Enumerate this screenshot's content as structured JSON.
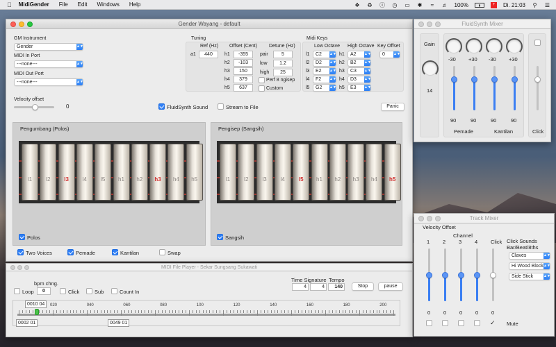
{
  "menubar": {
    "app": "MidiGender",
    "items": [
      "File",
      "Edit",
      "Windows",
      "Help"
    ],
    "battery": "100%",
    "clock": "Di. 21:03"
  },
  "main": {
    "title": "Gender Wayang - default",
    "gm_label": "GM Instrument",
    "gm_value": "Gender",
    "midi_in_label": "MIDI In Port",
    "midi_in_value": "---none---",
    "midi_out_label": "MIDI Out Port",
    "midi_out_value": "---none---",
    "tuning": {
      "label": "Tuning",
      "ref_label": "Ref (Hz)",
      "a1_label": "a1",
      "ref_value": "440",
      "offset_label": "Offset (Cent)",
      "detune_label": "Detune (Hz)",
      "rows": [
        {
          "n": "h1",
          "v": "-355"
        },
        {
          "n": "h2",
          "v": "-103"
        },
        {
          "n": "h3",
          "v": "150"
        },
        {
          "n": "h4",
          "v": "379"
        },
        {
          "n": "h5",
          "v": "637"
        }
      ],
      "detune": [
        {
          "n": "pair",
          "v": "5"
        },
        {
          "n": "low",
          "v": "1.2"
        },
        {
          "n": "high",
          "v": "25"
        }
      ],
      "perf_label": "Perf 8 ngisep",
      "custom_label": "Custom"
    },
    "midikeys": {
      "label": "Midi Keys",
      "low_label": "Low Octave",
      "high_label": "High Octave",
      "offset_label": "Key Offset",
      "offset_value": "0",
      "low": [
        {
          "n": "l1",
          "v": "C2"
        },
        {
          "n": "l2",
          "v": "D2"
        },
        {
          "n": "l3",
          "v": "E2"
        },
        {
          "n": "l4",
          "v": "F2"
        },
        {
          "n": "l5",
          "v": "G2"
        }
      ],
      "high": [
        {
          "n": "h1",
          "v": "A2"
        },
        {
          "n": "h2",
          "v": "B2"
        },
        {
          "n": "h3",
          "v": "C3"
        },
        {
          "n": "h4",
          "v": "D3"
        },
        {
          "n": "h5",
          "v": "E3"
        }
      ]
    },
    "velocity_label": "Velocity offset",
    "velocity_value": "0",
    "fluidsynth_label": "FluidSynth Sound",
    "stream_label": "Stream to File",
    "panic_label": "Panic",
    "polos_title": "Pengumbang (Polos)",
    "sangsih_title": "Pengisep (Sangsih)",
    "polos_bars": [
      "l1",
      "l2",
      "l3",
      "l4",
      "l5",
      "h1",
      "h2",
      "h3",
      "h4",
      "h5"
    ],
    "sangsih_bars": [
      "l1",
      "l2",
      "l3",
      "l4",
      "l5",
      "h1",
      "h2",
      "h3",
      "h4",
      "h5"
    ],
    "polos_red": [
      2,
      7
    ],
    "sangsih_red": [
      4,
      9
    ],
    "polos_chk": "Polos",
    "sangsih_chk": "Sangsih",
    "two_voices": "Two Voices",
    "pemade": "Pemade",
    "kantilan": "Kantilan",
    "swap": "Swap"
  },
  "fluid": {
    "title": "FluidSynth Mixer",
    "gain_label": "Gain",
    "gain_value": "14",
    "knobs": [
      "-30",
      "+30",
      "-30",
      "+30"
    ],
    "faders": [
      {
        "v": "90",
        "level": 0.7
      },
      {
        "v": "90",
        "level": 0.7
      },
      {
        "v": "90",
        "level": 0.7
      },
      {
        "v": "90",
        "level": 0.7
      },
      {
        "v": "",
        "level": 0.7
      }
    ],
    "groups": [
      "Pemade",
      "Kantilan",
      "Click"
    ]
  },
  "player": {
    "title": "MIDI File Player - Sekar Sungsang Sukawati",
    "loop": "Loop",
    "bpm_label": "bpm chng.",
    "bpm_value": "0",
    "click": "Click",
    "sub": "Sub",
    "countin": "Count In",
    "ts_label": "Time Signature",
    "tempo_label": "Tempo",
    "ts1": "4",
    "ts2": "4",
    "tempo": "140",
    "stop": "Stop",
    "pause": "pause",
    "ruler": [
      "020",
      "040",
      "060",
      "080",
      "100",
      "120",
      "140",
      "160",
      "180",
      "200"
    ],
    "pos": "0010 04",
    "start": "0002 01",
    "end": "0049 01"
  },
  "track": {
    "title": "Track Mixer",
    "velocity_label": "Velocity Offset",
    "channel_label": "Channel",
    "channels": [
      "1",
      "2",
      "3",
      "4",
      "Click"
    ],
    "values": [
      "0",
      "0",
      "0",
      "0",
      "0"
    ],
    "levels": [
      0.5,
      0.5,
      0.5,
      0.5,
      0.5
    ],
    "click_sounds_label": "Click Sounds\nBar/Beat/8ths",
    "click_sounds": [
      "Claves",
      "Hi Wood Block",
      "Side Stick"
    ],
    "mute_label": "Mute"
  }
}
